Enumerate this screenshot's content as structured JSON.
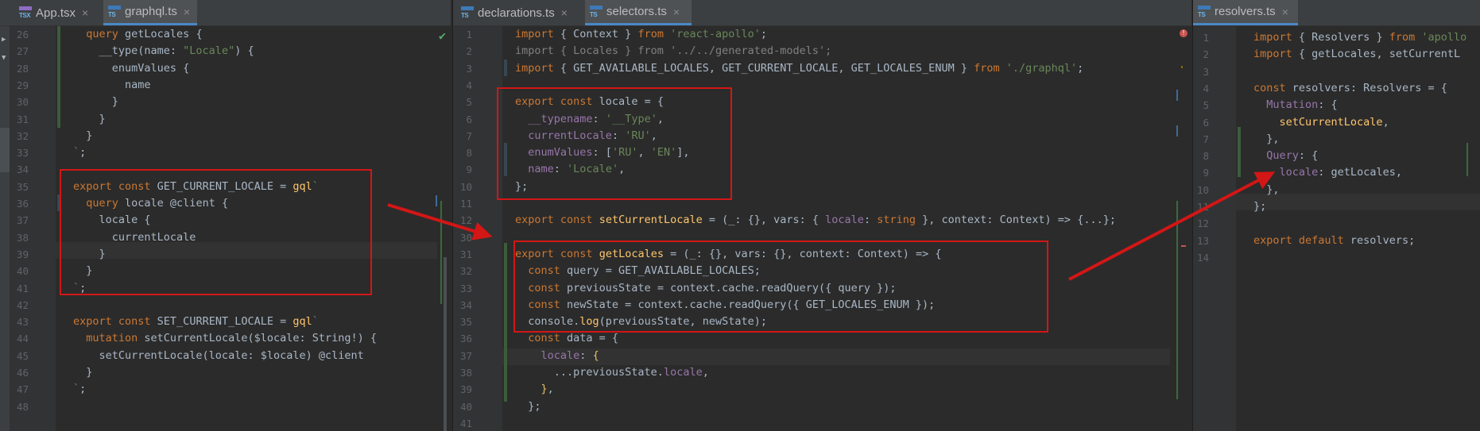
{
  "panes": {
    "left": {
      "tabs": [
        {
          "label": "App.tsx",
          "icon": "tsx-file-icon",
          "badge": "TSX"
        },
        {
          "label": "graphql.ts",
          "icon": "ts-file-icon",
          "badge": "TS"
        }
      ],
      "lines": [
        {
          "n": "26",
          "html": "  <span class='kw'>query</span> getLocales {"
        },
        {
          "n": "27",
          "html": "    __type(name: <span class='str'>\"Locale\"</span>) {"
        },
        {
          "n": "28",
          "html": "      enumValues {"
        },
        {
          "n": "29",
          "html": "        name"
        },
        {
          "n": "30",
          "html": "      }"
        },
        {
          "n": "31",
          "html": "    }"
        },
        {
          "n": "32",
          "html": "  }"
        },
        {
          "n": "33",
          "html": "<span class='str'>`</span>;"
        },
        {
          "n": "34",
          "html": ""
        },
        {
          "n": "35",
          "html": "<span class='kw'>export const</span> GET_CURRENT_LOCALE = <span class='fn'>gql</span><span class='str'>`</span>"
        },
        {
          "n": "36",
          "html": "  <span class='kw'>query</span> locale @client {"
        },
        {
          "n": "37",
          "html": "    locale {"
        },
        {
          "n": "38",
          "html": "      currentLocale"
        },
        {
          "n": "39",
          "html": "    }"
        },
        {
          "n": "40",
          "html": "  }"
        },
        {
          "n": "41",
          "html": "<span class='str'>`</span>;"
        },
        {
          "n": "42",
          "html": ""
        },
        {
          "n": "43",
          "html": "<span class='kw'>export const</span> SET_CURRENT_LOCALE = <span class='fn'>gql</span><span class='str'>`</span>"
        },
        {
          "n": "44",
          "html": "  <span class='kw'>mutation</span> setCurrentLocale($locale: String!) {"
        },
        {
          "n": "45",
          "html": "    setCurrentLocale(locale: $locale) @client"
        },
        {
          "n": "46",
          "html": "  }"
        },
        {
          "n": "47",
          "html": "<span class='str'>`</span>;"
        },
        {
          "n": "48",
          "html": ""
        }
      ]
    },
    "middle": {
      "tabs": [
        {
          "label": "declarations.ts",
          "icon": "ts-file-icon",
          "badge": "TS"
        },
        {
          "label": "selectors.ts",
          "icon": "ts-file-icon",
          "badge": "TS"
        }
      ],
      "lines": [
        {
          "n": "1",
          "html": "<span class='kw'>import</span> { Context } <span class='kw'>from</span> <span class='str'>'react-apollo'</span>;"
        },
        {
          "n": "2",
          "html": "<span class='dim'>import { Locales } from '../../generated-models';</span>"
        },
        {
          "n": "3",
          "html": "<span class='kw'>import</span> { GET_AVAILABLE_LOCALES, GET_CURRENT_LOCALE, GET_LOCALES_ENUM } <span class='kw'>from</span> <span class='str'>'./graphql'</span>;"
        },
        {
          "n": "4",
          "html": ""
        },
        {
          "n": "5",
          "html": "<span class='kw'>export const</span> locale = {"
        },
        {
          "n": "6",
          "html": "  <span class='prop'>__typename</span>: <span class='str'>'__Type'</span>,"
        },
        {
          "n": "7",
          "html": "  <span class='prop'>currentLocale</span>: <span class='str'>'RU'</span>,"
        },
        {
          "n": "8",
          "html": "  <span class='prop'>enumValues</span>: [<span class='str'>'RU'</span>, <span class='str'>'EN'</span>],"
        },
        {
          "n": "9",
          "html": "  <span class='prop'>name</span>: <span class='str'>'Locale'</span>,"
        },
        {
          "n": "10",
          "html": "};"
        },
        {
          "n": "11",
          "html": ""
        },
        {
          "n": "12",
          "html": "<span class='kw'>export const</span> <span class='fn'>setCurrentLocale</span> = (_: {}, vars: { <span class='prop'>locale</span>: <span class='kw'>string</span> }, context: Context) => {...};"
        },
        {
          "n": "30",
          "html": ""
        },
        {
          "n": "31",
          "html": "<span class='kw'>export const</span> <span class='fn'>getLocales</span> = (_: {}, vars: {}, context: Context) => {"
        },
        {
          "n": "32",
          "html": "  <span class='kw'>const</span> query = GET_AVAILABLE_LOCALES;"
        },
        {
          "n": "33",
          "html": "  <span class='kw'>const</span> previousState = context.cache.readQuery({ query });"
        },
        {
          "n": "34",
          "html": "  <span class='kw'>const</span> newState = context.cache.readQuery({ GET_LOCALES_ENUM });"
        },
        {
          "n": "35",
          "html": "  console.<span class='fn'>log</span>(previousState, newState);"
        },
        {
          "n": "36",
          "html": "  <span class='kw'>const</span> data = {"
        },
        {
          "n": "37",
          "html": "    <span class='prop'>locale</span>: <span class='tt'>{</span>"
        },
        {
          "n": "38",
          "html": "      ...previousState.<span class='prop'>locale</span>,"
        },
        {
          "n": "39",
          "html": "    <span class='tt'>}</span>,"
        },
        {
          "n": "40",
          "html": "  };"
        },
        {
          "n": "41",
          "html": ""
        }
      ]
    },
    "right": {
      "tabs": [
        {
          "label": "resolvers.ts",
          "icon": "ts-file-icon",
          "badge": "TS"
        }
      ],
      "lines": [
        {
          "n": "1",
          "html": "<span class='kw'>import</span> { Resolvers } <span class='kw'>from</span> <span class='str'>'apollo</span>"
        },
        {
          "n": "2",
          "html": "<span class='kw'>import</span> { getLocales, setCurrentL"
        },
        {
          "n": "3",
          "html": ""
        },
        {
          "n": "4",
          "html": "<span class='kw'>const</span> resolvers: Resolvers = {"
        },
        {
          "n": "5",
          "html": "  <span class='prop'>Mutation</span>: {"
        },
        {
          "n": "6",
          "html": "    <span class='fn'>setCurrentLocale</span>,"
        },
        {
          "n": "7",
          "html": "  },"
        },
        {
          "n": "8",
          "html": "  <span class='prop'>Query</span>: {"
        },
        {
          "n": "9",
          "html": "    <span class='prop'>locale</span>: getLocales,"
        },
        {
          "n": "10",
          "html": "  },"
        },
        {
          "n": "11",
          "html": "};"
        },
        {
          "n": "12",
          "html": ""
        },
        {
          "n": "13",
          "html": "<span class='kw'>export default</span> resolvers;"
        },
        {
          "n": "14",
          "html": ""
        }
      ]
    }
  },
  "colors": {
    "annotation_red": "#d31616",
    "keyword": "#cc7832",
    "string": "#6a8759",
    "function": "#ffc66d",
    "property": "#9876aa"
  }
}
